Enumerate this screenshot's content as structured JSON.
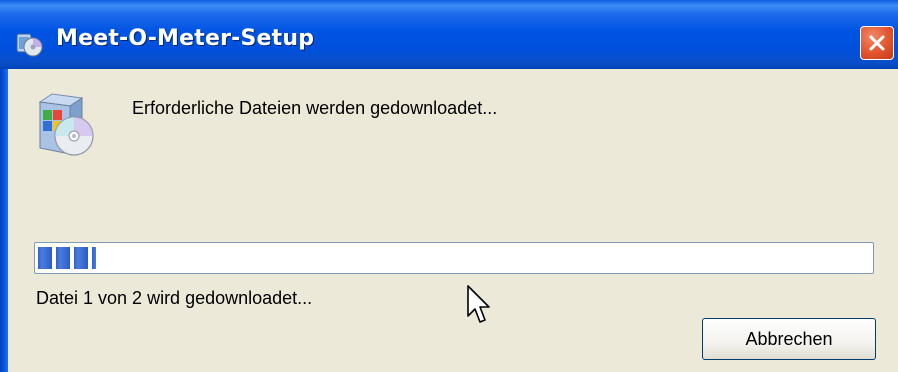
{
  "window": {
    "title": "Meet-O-Meter-Setup",
    "close_icon": "close-icon"
  },
  "content": {
    "status_message": "Erforderliche Dateien werden gedownloadet...",
    "file_status": "Datei 1 von 2 wird gedownloadet...",
    "progress_fraction": 0.07,
    "icon": "setup-cd-icon"
  },
  "buttons": {
    "cancel_label": "Abbrechen"
  },
  "colors": {
    "titlebar": "#0054e3",
    "dialog_background": "#ece9d8",
    "progress_fill": "#2f61c8",
    "close_button": "#e2542d"
  }
}
